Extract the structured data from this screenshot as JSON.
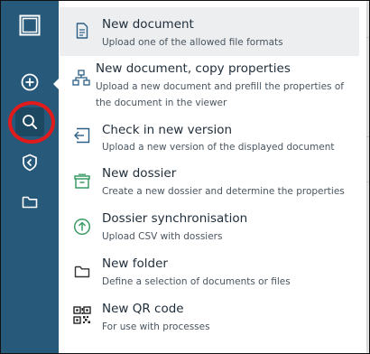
{
  "sidebar": {
    "icons": [
      "logo-square-icon",
      "add-circle-icon",
      "search-icon",
      "shield-icon",
      "folder-icon"
    ],
    "active": "search-icon",
    "background": "#27597a"
  },
  "menu": {
    "items": [
      {
        "icon": "document-icon",
        "title": "New document",
        "description": "Upload one of the allowed file formats",
        "hovered": true
      },
      {
        "icon": "hierarchy-icon",
        "title": "New document, copy properties",
        "description": "Upload a new document and prefill the properties of the document in the viewer"
      },
      {
        "icon": "check-in-icon",
        "title": "Check in new version",
        "description": "Upload a new version of the displayed document"
      },
      {
        "icon": "dossier-icon",
        "title": "New dossier",
        "description": "Create a new dossier and determine the properties",
        "icon_color": "#3a9a63"
      },
      {
        "icon": "sync-upload-icon",
        "title": "Dossier synchronisation",
        "description": "Upload CSV with dossiers",
        "icon_color": "#3a9a63"
      },
      {
        "icon": "folder-icon",
        "title": "New folder",
        "description": "Define a selection of documents or files"
      },
      {
        "icon": "qr-code-icon",
        "title": "New QR code",
        "description": "For use with processes"
      }
    ]
  },
  "highlight_color": "#e11b1b"
}
